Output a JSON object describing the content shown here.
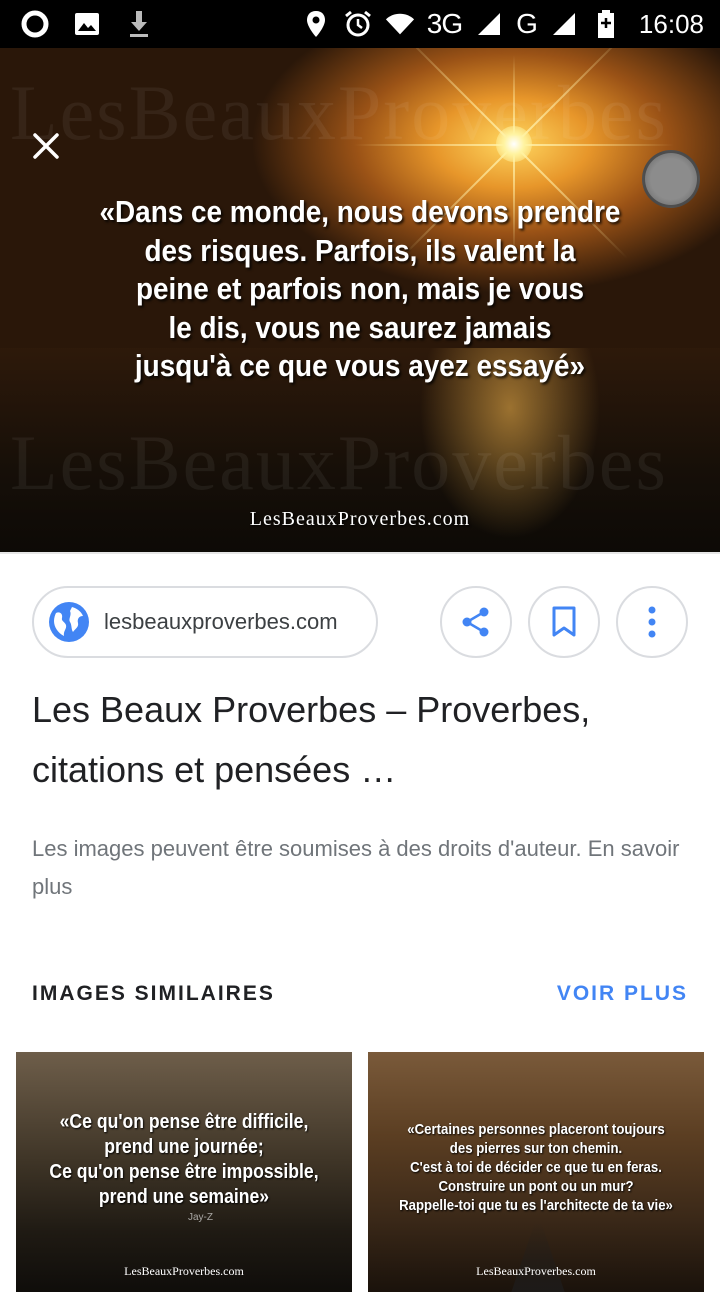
{
  "status_bar": {
    "network_label": "3G",
    "network2_label": "G",
    "time": "16:08"
  },
  "hero": {
    "watermark": "LesBeauxProverbes",
    "quote_lines": [
      "«Dans ce monde, nous devons prendre",
      "des risques. Parfois, ils valent la",
      "peine et parfois non, mais je vous",
      "le dis, vous ne saurez jamais",
      "jusqu'à ce que vous ayez essayé»"
    ],
    "brand": "LesBeauxProverbes.com"
  },
  "source": {
    "domain": "lesbeauxproverbes.com",
    "icon": "globe-icon"
  },
  "actions": {
    "share_icon": "share-icon",
    "save_icon": "bookmark-icon",
    "more_icon": "more-vert-icon"
  },
  "result": {
    "title": "Les Beaux Proverbes – Proverbes, citations et pensées …",
    "copyright_notice": "Les images peuvent être soumises à des droits d'auteur. En savoir plus"
  },
  "similar": {
    "heading": "IMAGES SIMILAIRES",
    "more_label": "VOIR PLUS",
    "accent_color": "#4285f4",
    "items": [
      {
        "quote_lines": [
          "«Ce qu'on pense être difficile,",
          "prend une journée;",
          "Ce qu'on pense être impossible,",
          "prend une semaine»"
        ],
        "author": "Jay-Z",
        "brand": "LesBeauxProverbes.com"
      },
      {
        "quote_lines": [
          "«Certaines personnes placeront toujours",
          "des pierres sur ton chemin.",
          "C'est à toi de décider ce que tu en feras.",
          "Construire un pont ou un mur?",
          "Rappelle-toi que tu es l'architecte de ta vie»"
        ],
        "brand": "LesBeauxProverbes.com"
      }
    ]
  }
}
